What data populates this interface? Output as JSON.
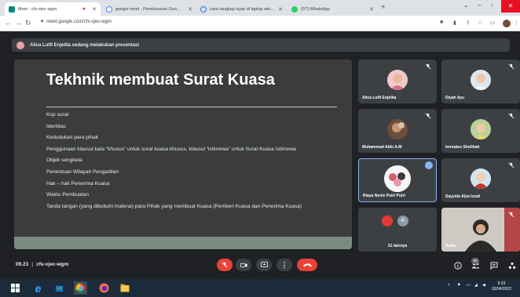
{
  "browser": {
    "tabs": [
      {
        "label": "Meet - cfs-vjec-wgm",
        "active": true
      },
      {
        "label": "google meet - Penelusuran Goo...",
        "active": false
      },
      {
        "label": "cara tangkap layar di laptop win...",
        "active": false
      },
      {
        "label": "(37) WhatsApp",
        "active": false
      }
    ],
    "new_tab": "+",
    "url": "meet.google.com/cfs-vjec-wgm"
  },
  "meet": {
    "presenter_notice": "Alica Lutfi Enjelita sedang melakukan presentasi",
    "slide": {
      "title": "Tekhnik membuat Surat Kuasa",
      "bullets": [
        "Kop surat",
        "Identitas",
        "Kedudukan para pihak",
        "Penggunaan klausul kata “khusus” untuk surat kuasa khusus, klausul “istimewa” untuk Surat Kuasa Istimewa",
        "Objek sengketa",
        "Penentuan Wilayah Pengadilan",
        "Hak – hak Penerima Kuasa",
        "Waktu Pembuatan",
        "Tanda tangan (yang dibubuhi materai) para Pihak yang membuat Kuasa (Pemberi Kuasa dan Penerima Kuasa)"
      ]
    },
    "participants": [
      {
        "name": "Alica Lutfi Enjelita"
      },
      {
        "name": "Diyah Ayu"
      },
      {
        "name": "Muhammad Aldo A.M"
      },
      {
        "name": "Imroatus Sholihah"
      },
      {
        "name": "Riaya Novie Putri Putri"
      },
      {
        "name": "Sayyida Alya Izzati"
      },
      {
        "name": "51 lainnya",
        "avatar_letter": "A"
      },
      {
        "name": "Anda"
      }
    ],
    "controls": {
      "time": "09.23",
      "meeting_code": "cfs-vjec-wgm",
      "people_count": "59"
    }
  },
  "taskbar": {
    "clock_time": "9.23",
    "clock_date": "02/04/2022"
  },
  "colors": {
    "meet_bg": "#202124",
    "tile_bg": "#3c4043",
    "end_call": "#ea4335",
    "active_speaker": "#8ab4f8"
  }
}
